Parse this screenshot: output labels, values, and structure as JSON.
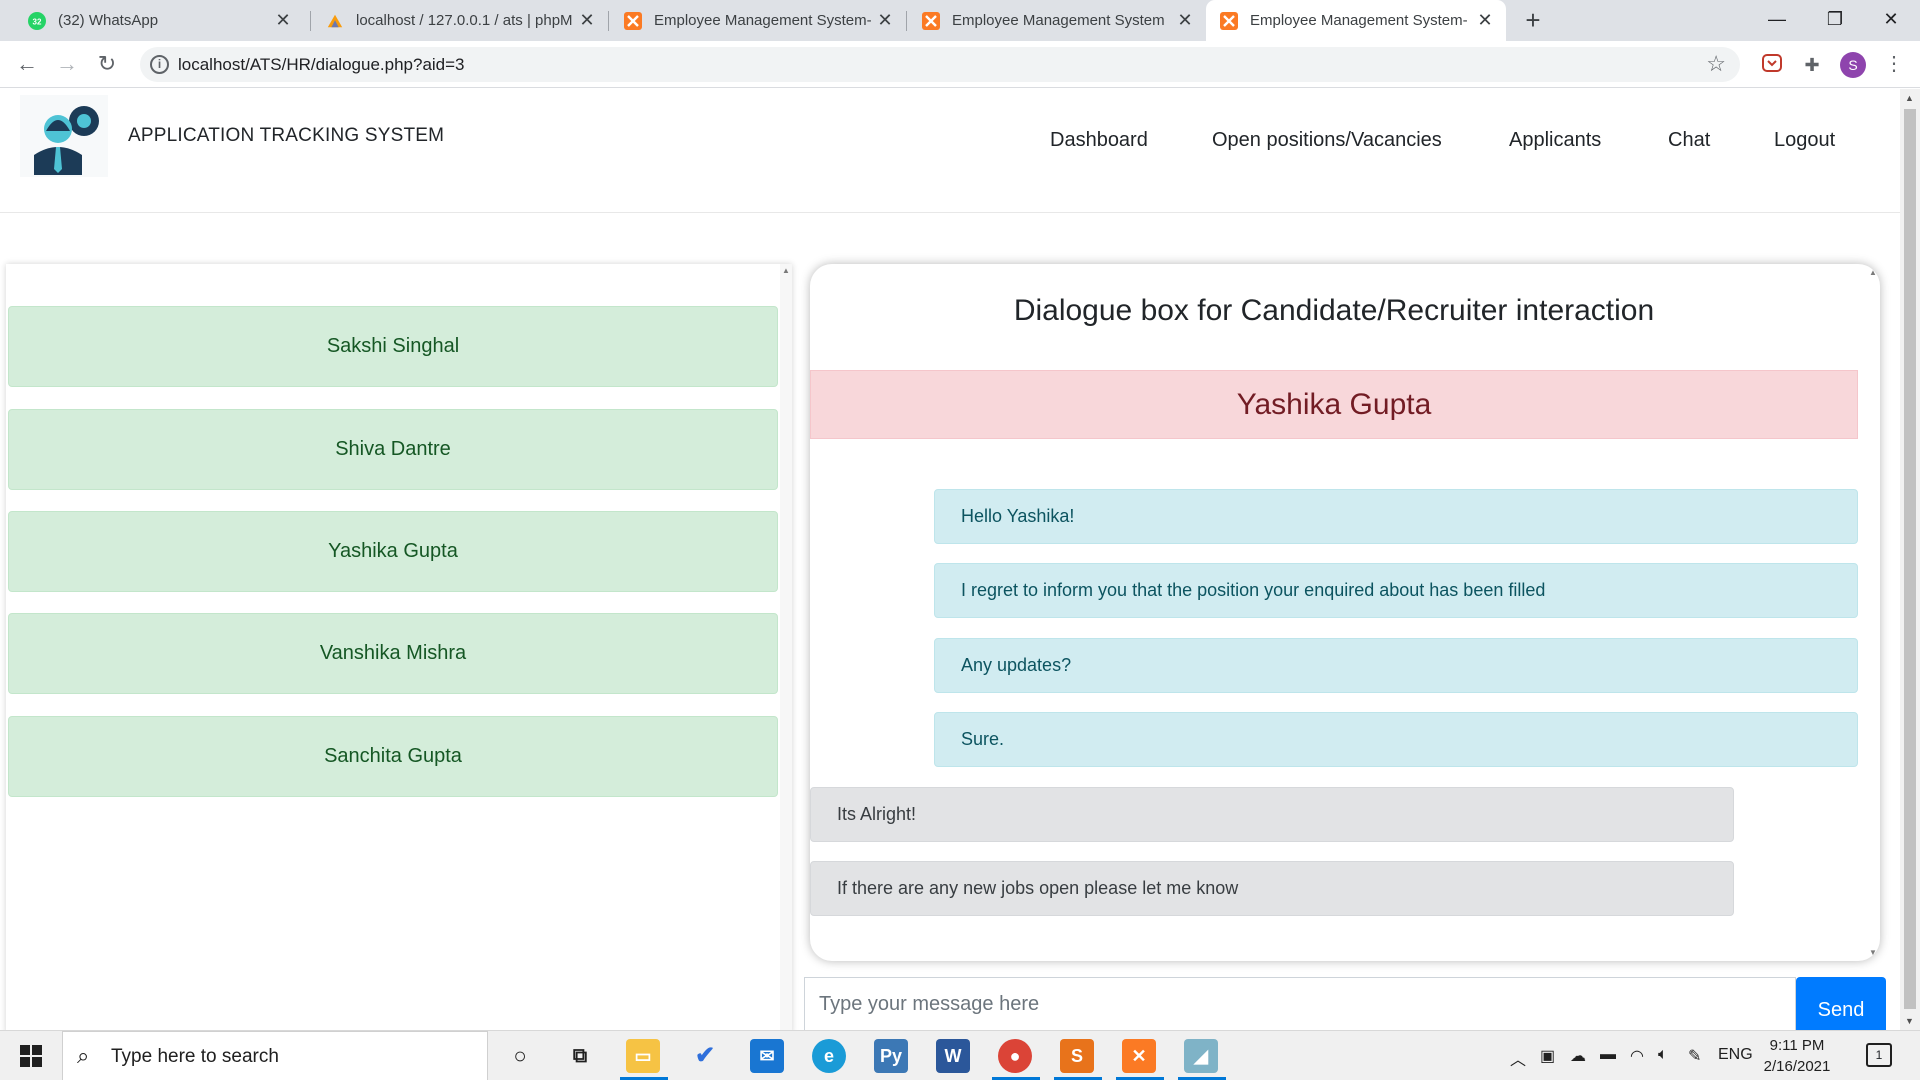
{
  "browser": {
    "tabs": [
      {
        "title": "(32) WhatsApp",
        "badge": "32"
      },
      {
        "title": "localhost / 127.0.0.1 / ats | phpM"
      },
      {
        "title": "Employee Management System-"
      },
      {
        "title": "Employee Management System"
      },
      {
        "title": "Employee Management System-"
      }
    ],
    "url": "localhost/ATS/HR/dialogue.php?aid=3",
    "profile_initial": "S"
  },
  "header": {
    "app_title": "APPLICATION TRACKING SYSTEM",
    "nav": [
      "Dashboard",
      "Open positions/Vacancies",
      "Applicants",
      "Chat",
      "Logout"
    ]
  },
  "candidates": [
    "Sakshi Singhal",
    "Shiva Dantre",
    "Yashika Gupta",
    "Vanshika Mishra",
    "Sanchita Gupta"
  ],
  "dialog": {
    "title": "Dialogue box for Candidate/Recruiter interaction",
    "contact_name": "Yashika Gupta",
    "messages": [
      {
        "text": "Hello Yashika!",
        "side": "sent"
      },
      {
        "text": "I regret to inform you that the position your enquired about has been filled",
        "side": "sent"
      },
      {
        "text": "Any updates?",
        "side": "sent"
      },
      {
        "text": "Sure.",
        "side": "sent"
      },
      {
        "text": "Its Alright!",
        "side": "received"
      },
      {
        "text": "If there are any new jobs open please let me know",
        "side": "received"
      }
    ],
    "input_placeholder": "Type your message here",
    "send_label": "Send"
  },
  "taskbar": {
    "search_placeholder": "Type here to search",
    "language": "ENG",
    "time": "9:11 PM",
    "date": "2/16/2021",
    "notification_count": "1"
  },
  "colors": {
    "candidate_bg": "#d4edda",
    "candidate_text": "#155724",
    "contact_bg": "#f8d7da",
    "contact_text": "#721c24",
    "sent_bg": "#d1ecf1",
    "received_bg": "#e2e3e5",
    "send_button": "#007bff"
  }
}
